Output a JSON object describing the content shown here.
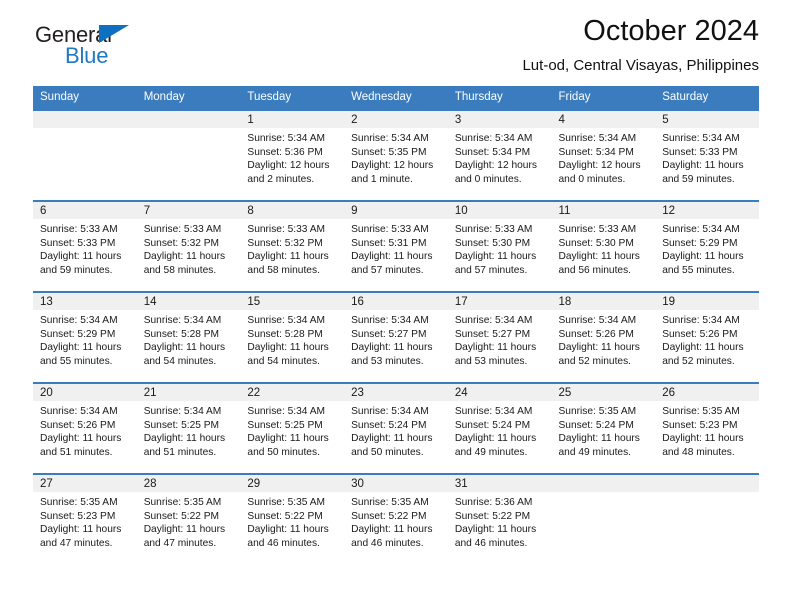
{
  "logo": {
    "text_top": "General",
    "text_bottom": "Blue",
    "triangle_icon": "triangle-icon",
    "color_dark": "#231f20",
    "color_blue": "#1f7ac4"
  },
  "header": {
    "title": "October 2024",
    "subtitle": "Lut-od, Central Visayas, Philippines"
  },
  "theme": {
    "header_bar": "#3a7cbe",
    "daynum_band": "#f0f0f0",
    "cell_background": "#ffffff",
    "text": "#1a1a1a"
  },
  "weekday_headers": [
    "Sunday",
    "Monday",
    "Tuesday",
    "Wednesday",
    "Thursday",
    "Friday",
    "Saturday"
  ],
  "labels": {
    "sunrise_prefix": "Sunrise:",
    "sunset_prefix": "Sunset:",
    "daylight_prefix": "Daylight:"
  },
  "weeks": [
    [
      {
        "day": "",
        "sunrise": "",
        "sunset": "",
        "daylight_line1": "",
        "daylight_line2": ""
      },
      {
        "day": "",
        "sunrise": "",
        "sunset": "",
        "daylight_line1": "",
        "daylight_line2": ""
      },
      {
        "day": "1",
        "sunrise": "Sunrise: 5:34 AM",
        "sunset": "Sunset: 5:36 PM",
        "daylight_line1": "Daylight: 12 hours",
        "daylight_line2": "and 2 minutes."
      },
      {
        "day": "2",
        "sunrise": "Sunrise: 5:34 AM",
        "sunset": "Sunset: 5:35 PM",
        "daylight_line1": "Daylight: 12 hours",
        "daylight_line2": "and 1 minute."
      },
      {
        "day": "3",
        "sunrise": "Sunrise: 5:34 AM",
        "sunset": "Sunset: 5:34 PM",
        "daylight_line1": "Daylight: 12 hours",
        "daylight_line2": "and 0 minutes."
      },
      {
        "day": "4",
        "sunrise": "Sunrise: 5:34 AM",
        "sunset": "Sunset: 5:34 PM",
        "daylight_line1": "Daylight: 12 hours",
        "daylight_line2": "and 0 minutes."
      },
      {
        "day": "5",
        "sunrise": "Sunrise: 5:34 AM",
        "sunset": "Sunset: 5:33 PM",
        "daylight_line1": "Daylight: 11 hours",
        "daylight_line2": "and 59 minutes."
      }
    ],
    [
      {
        "day": "6",
        "sunrise": "Sunrise: 5:33 AM",
        "sunset": "Sunset: 5:33 PM",
        "daylight_line1": "Daylight: 11 hours",
        "daylight_line2": "and 59 minutes."
      },
      {
        "day": "7",
        "sunrise": "Sunrise: 5:33 AM",
        "sunset": "Sunset: 5:32 PM",
        "daylight_line1": "Daylight: 11 hours",
        "daylight_line2": "and 58 minutes."
      },
      {
        "day": "8",
        "sunrise": "Sunrise: 5:33 AM",
        "sunset": "Sunset: 5:32 PM",
        "daylight_line1": "Daylight: 11 hours",
        "daylight_line2": "and 58 minutes."
      },
      {
        "day": "9",
        "sunrise": "Sunrise: 5:33 AM",
        "sunset": "Sunset: 5:31 PM",
        "daylight_line1": "Daylight: 11 hours",
        "daylight_line2": "and 57 minutes."
      },
      {
        "day": "10",
        "sunrise": "Sunrise: 5:33 AM",
        "sunset": "Sunset: 5:30 PM",
        "daylight_line1": "Daylight: 11 hours",
        "daylight_line2": "and 57 minutes."
      },
      {
        "day": "11",
        "sunrise": "Sunrise: 5:33 AM",
        "sunset": "Sunset: 5:30 PM",
        "daylight_line1": "Daylight: 11 hours",
        "daylight_line2": "and 56 minutes."
      },
      {
        "day": "12",
        "sunrise": "Sunrise: 5:34 AM",
        "sunset": "Sunset: 5:29 PM",
        "daylight_line1": "Daylight: 11 hours",
        "daylight_line2": "and 55 minutes."
      }
    ],
    [
      {
        "day": "13",
        "sunrise": "Sunrise: 5:34 AM",
        "sunset": "Sunset: 5:29 PM",
        "daylight_line1": "Daylight: 11 hours",
        "daylight_line2": "and 55 minutes."
      },
      {
        "day": "14",
        "sunrise": "Sunrise: 5:34 AM",
        "sunset": "Sunset: 5:28 PM",
        "daylight_line1": "Daylight: 11 hours",
        "daylight_line2": "and 54 minutes."
      },
      {
        "day": "15",
        "sunrise": "Sunrise: 5:34 AM",
        "sunset": "Sunset: 5:28 PM",
        "daylight_line1": "Daylight: 11 hours",
        "daylight_line2": "and 54 minutes."
      },
      {
        "day": "16",
        "sunrise": "Sunrise: 5:34 AM",
        "sunset": "Sunset: 5:27 PM",
        "daylight_line1": "Daylight: 11 hours",
        "daylight_line2": "and 53 minutes."
      },
      {
        "day": "17",
        "sunrise": "Sunrise: 5:34 AM",
        "sunset": "Sunset: 5:27 PM",
        "daylight_line1": "Daylight: 11 hours",
        "daylight_line2": "and 53 minutes."
      },
      {
        "day": "18",
        "sunrise": "Sunrise: 5:34 AM",
        "sunset": "Sunset: 5:26 PM",
        "daylight_line1": "Daylight: 11 hours",
        "daylight_line2": "and 52 minutes."
      },
      {
        "day": "19",
        "sunrise": "Sunrise: 5:34 AM",
        "sunset": "Sunset: 5:26 PM",
        "daylight_line1": "Daylight: 11 hours",
        "daylight_line2": "and 52 minutes."
      }
    ],
    [
      {
        "day": "20",
        "sunrise": "Sunrise: 5:34 AM",
        "sunset": "Sunset: 5:26 PM",
        "daylight_line1": "Daylight: 11 hours",
        "daylight_line2": "and 51 minutes."
      },
      {
        "day": "21",
        "sunrise": "Sunrise: 5:34 AM",
        "sunset": "Sunset: 5:25 PM",
        "daylight_line1": "Daylight: 11 hours",
        "daylight_line2": "and 51 minutes."
      },
      {
        "day": "22",
        "sunrise": "Sunrise: 5:34 AM",
        "sunset": "Sunset: 5:25 PM",
        "daylight_line1": "Daylight: 11 hours",
        "daylight_line2": "and 50 minutes."
      },
      {
        "day": "23",
        "sunrise": "Sunrise: 5:34 AM",
        "sunset": "Sunset: 5:24 PM",
        "daylight_line1": "Daylight: 11 hours",
        "daylight_line2": "and 50 minutes."
      },
      {
        "day": "24",
        "sunrise": "Sunrise: 5:34 AM",
        "sunset": "Sunset: 5:24 PM",
        "daylight_line1": "Daylight: 11 hours",
        "daylight_line2": "and 49 minutes."
      },
      {
        "day": "25",
        "sunrise": "Sunrise: 5:35 AM",
        "sunset": "Sunset: 5:24 PM",
        "daylight_line1": "Daylight: 11 hours",
        "daylight_line2": "and 49 minutes."
      },
      {
        "day": "26",
        "sunrise": "Sunrise: 5:35 AM",
        "sunset": "Sunset: 5:23 PM",
        "daylight_line1": "Daylight: 11 hours",
        "daylight_line2": "and 48 minutes."
      }
    ],
    [
      {
        "day": "27",
        "sunrise": "Sunrise: 5:35 AM",
        "sunset": "Sunset: 5:23 PM",
        "daylight_line1": "Daylight: 11 hours",
        "daylight_line2": "and 47 minutes."
      },
      {
        "day": "28",
        "sunrise": "Sunrise: 5:35 AM",
        "sunset": "Sunset: 5:22 PM",
        "daylight_line1": "Daylight: 11 hours",
        "daylight_line2": "and 47 minutes."
      },
      {
        "day": "29",
        "sunrise": "Sunrise: 5:35 AM",
        "sunset": "Sunset: 5:22 PM",
        "daylight_line1": "Daylight: 11 hours",
        "daylight_line2": "and 46 minutes."
      },
      {
        "day": "30",
        "sunrise": "Sunrise: 5:35 AM",
        "sunset": "Sunset: 5:22 PM",
        "daylight_line1": "Daylight: 11 hours",
        "daylight_line2": "and 46 minutes."
      },
      {
        "day": "31",
        "sunrise": "Sunrise: 5:36 AM",
        "sunset": "Sunset: 5:22 PM",
        "daylight_line1": "Daylight: 11 hours",
        "daylight_line2": "and 46 minutes."
      },
      {
        "day": "",
        "sunrise": "",
        "sunset": "",
        "daylight_line1": "",
        "daylight_line2": ""
      },
      {
        "day": "",
        "sunrise": "",
        "sunset": "",
        "daylight_line1": "",
        "daylight_line2": ""
      }
    ]
  ]
}
